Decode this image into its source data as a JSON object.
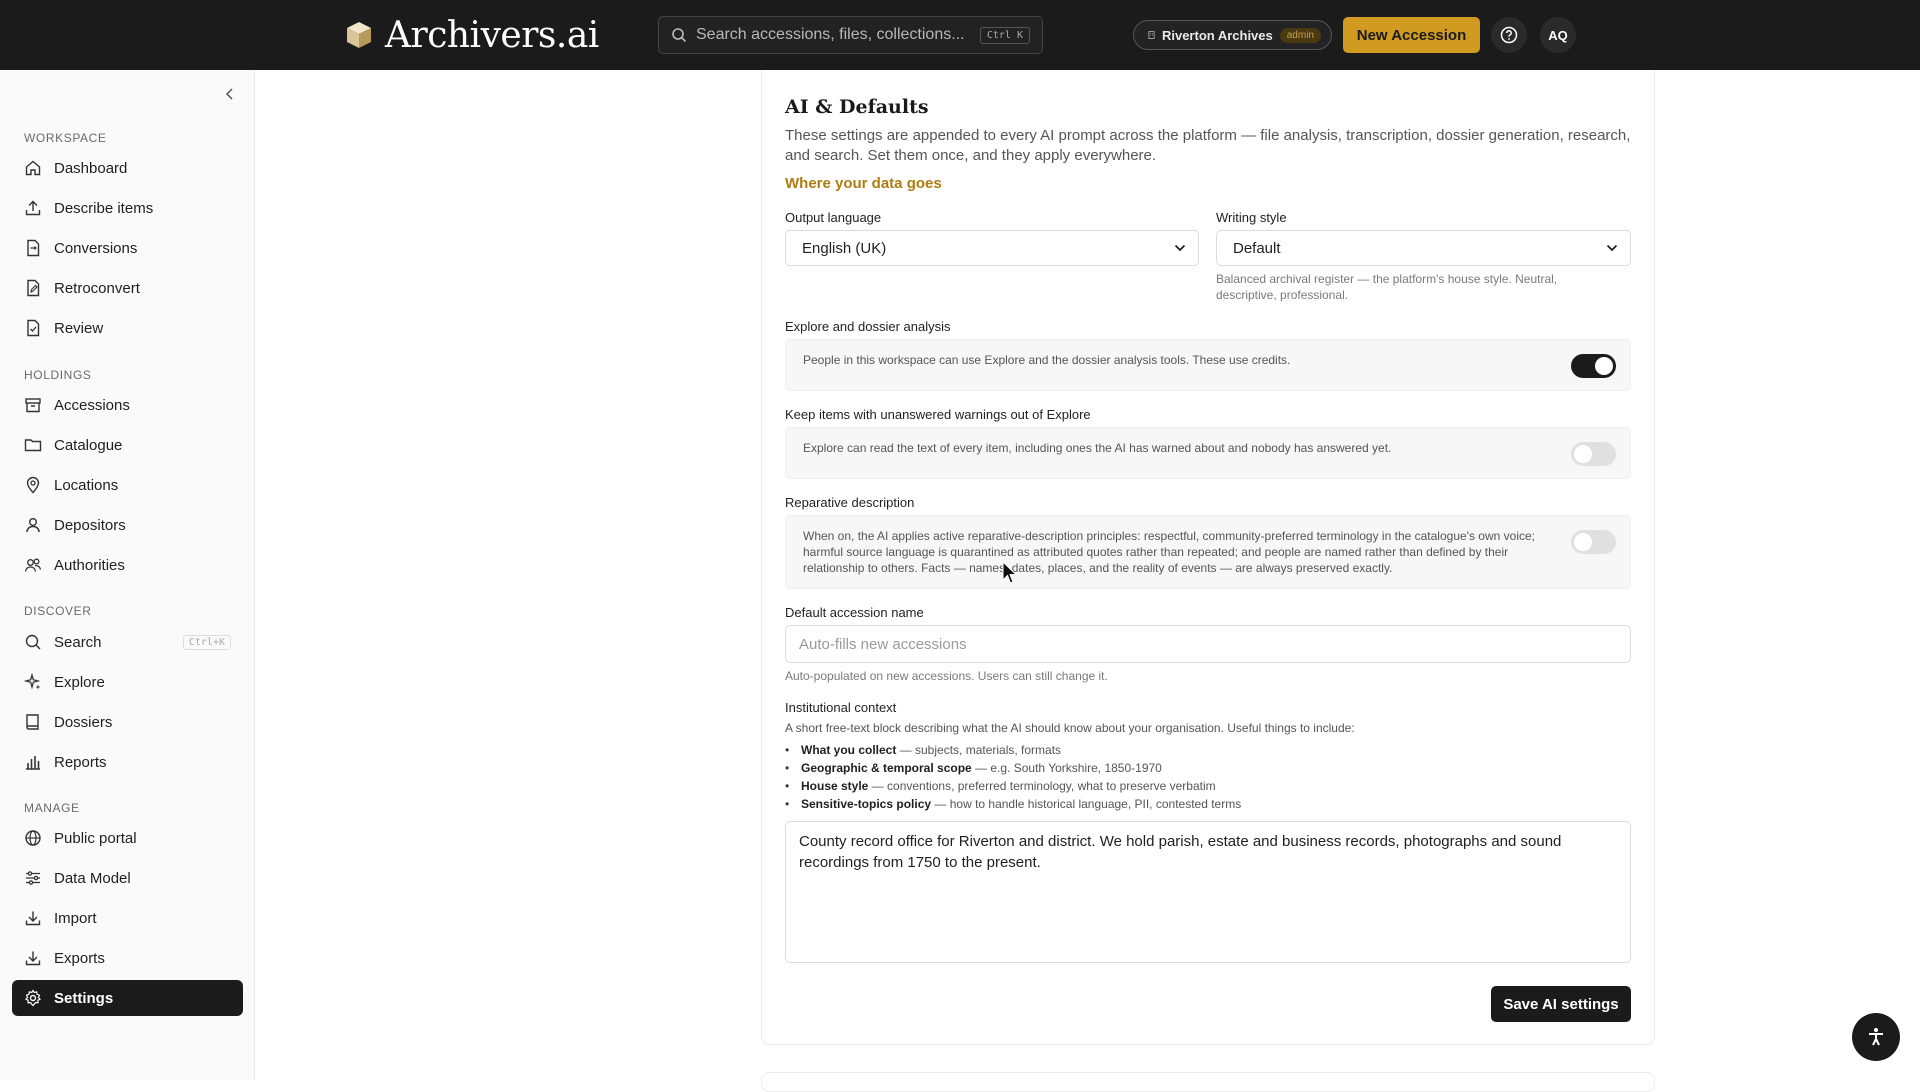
{
  "brand": {
    "name": "Archivers.ai",
    "logo_icon": "box-logo-icon"
  },
  "search": {
    "placeholder": "Search accessions, files, collections...",
    "shortcut": "Ctrl K"
  },
  "org": {
    "name": "Riverton Archives",
    "role": "admin"
  },
  "header": {
    "new_button": "New Accession",
    "help_icon": "question-circle-icon",
    "avatar_initials": "AQ"
  },
  "sidebar": {
    "sections": {
      "workspace": "WORKSPACE",
      "holdings": "HOLDINGS",
      "discover": "DISCOVER",
      "manage": "MANAGE"
    },
    "items": [
      {
        "label": "Dashboard",
        "icon": "home-icon"
      },
      {
        "label": "Describe items",
        "icon": "upload-icon"
      },
      {
        "label": "Conversions",
        "icon": "file-convert-icon"
      },
      {
        "label": "Retroconvert",
        "icon": "file-edit-icon"
      },
      {
        "label": "Review",
        "icon": "file-check-icon"
      },
      {
        "label": "Accessions",
        "icon": "archive-box-icon"
      },
      {
        "label": "Catalogue",
        "icon": "folder-icon"
      },
      {
        "label": "Locations",
        "icon": "map-pin-icon"
      },
      {
        "label": "Depositors",
        "icon": "user-icon"
      },
      {
        "label": "Authorities",
        "icon": "users-icon"
      },
      {
        "label": "Search",
        "icon": "search-icon",
        "shortcut": "Ctrl+K"
      },
      {
        "label": "Explore",
        "icon": "sparkles-icon"
      },
      {
        "label": "Dossiers",
        "icon": "book-icon"
      },
      {
        "label": "Reports",
        "icon": "bar-chart-icon"
      },
      {
        "label": "Public portal",
        "icon": "globe-icon"
      },
      {
        "label": "Data Model",
        "icon": "sliders-icon"
      },
      {
        "label": "Import",
        "icon": "download-icon"
      },
      {
        "label": "Exports",
        "icon": "export-icon"
      },
      {
        "label": "Settings",
        "icon": "gear-icon",
        "active": true
      }
    ]
  },
  "ai_defaults": {
    "title": "AI & Defaults",
    "intro": "These settings are appended to every AI prompt across the platform — file analysis, transcription, dossier generation, research, and search. Set them once, and they apply everywhere.",
    "data_link": "Where your data goes",
    "output_language": {
      "label": "Output language",
      "value": "English (UK)"
    },
    "writing_style": {
      "label": "Writing style",
      "value": "Default",
      "hint": "Balanced archival register — the platform's house style. Neutral, descriptive, professional."
    },
    "explore_toggle": {
      "label": "Explore and dossier analysis",
      "text": "People in this workspace can use Explore and the dossier analysis tools. These use credits.",
      "on": true
    },
    "warnings_toggle": {
      "label": "Keep items with unanswered warnings out of Explore",
      "text": "Explore can read the text of every item, including ones the AI has warned about and nobody has answered yet.",
      "on": false
    },
    "reparative_toggle": {
      "label": "Reparative description",
      "text": "When on, the AI applies active reparative-description principles: respectful, community-preferred terminology in the catalogue's own voice; harmful source language is quarantined as attributed quotes rather than repeated; and people are named rather than defined by their relationship to others. Facts — names, dates, places, and the reality of events — are always preserved exactly.",
      "on": false
    },
    "accession_name": {
      "label": "Default accession name",
      "placeholder": "Auto-fills new accessions",
      "value": "",
      "hint": "Auto-populated on new accessions. Users can still change it."
    },
    "institutional_context": {
      "label": "Institutional context",
      "description": "A short free-text block describing what the AI should know about your organisation. Useful things to include:",
      "bullets": [
        {
          "term": "What you collect",
          "rest": " — subjects, materials, formats"
        },
        {
          "term": "Geographic & temporal scope",
          "rest": " — e.g. South Yorkshire, 1850-1970"
        },
        {
          "term": "House style",
          "rest": " — conventions, preferred terminology, what to preserve verbatim"
        },
        {
          "term": "Sensitive-topics policy",
          "rest": " — how to handle historical language, PII, contested terms"
        }
      ],
      "value": "County record office for Riverton and district. We hold parish, estate and business records, photographs and sound recordings from 1750 to the present."
    },
    "save_button": "Save AI settings"
  },
  "colors": {
    "accent": "#d19b22",
    "dark": "#1b1b1b",
    "link": "#b07c10"
  }
}
